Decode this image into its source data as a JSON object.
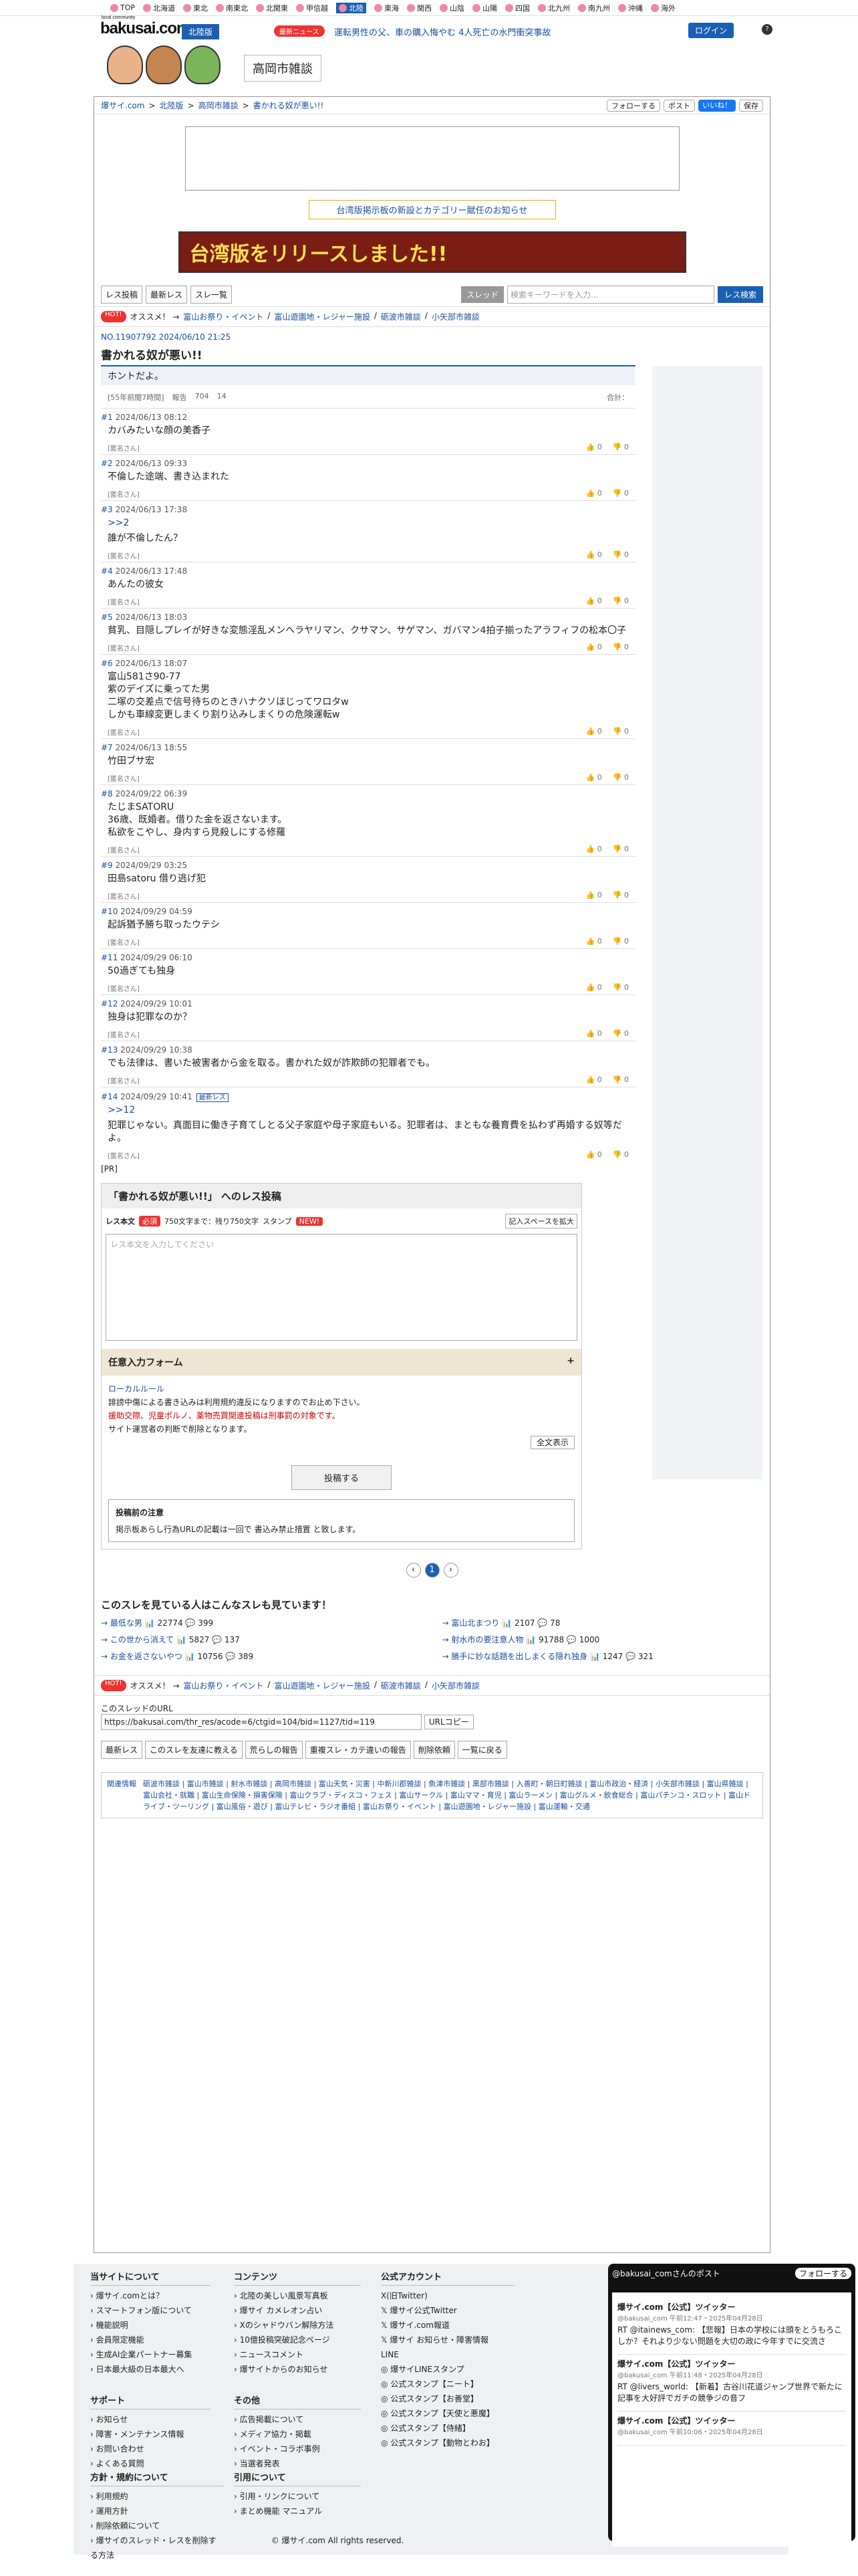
{
  "topnav": [
    "TOP",
    "北海道",
    "東北",
    "南東北",
    "北関東",
    "甲信越",
    "北陸",
    "東海",
    "関西",
    "山陰",
    "山陽",
    "四国",
    "北九州",
    "南九州",
    "沖縄",
    "海外"
  ],
  "topnav_active": "北陸",
  "header": {
    "logo": "bakusai.com",
    "logo_small": "local community",
    "region": "北陸版",
    "news_badge": "最新ニュース",
    "news_text": "運転男性の父、車の購入悔やむ 4人死亡の水門衝突事故",
    "login": "ログイン",
    "help": "?"
  },
  "bbs_label": "高岡市雑談",
  "breadcrumb": [
    "爆サイ.com",
    "北陸版",
    "高岡市雑談",
    "書かれる奴が悪い!!"
  ],
  "follow": {
    "x": "フォローする",
    "post": "ポスト",
    "fb": "いいね！",
    "save": "保存"
  },
  "notice": "台湾版掲示板の新設とカテゴリー賦任のお知らせ",
  "promo": "台湾版をリリースしました!!",
  "controls": {
    "btns": [
      "レス投稿",
      "最新レス",
      "スレ一覧"
    ],
    "select": "スレッド",
    "placeholder": "検索キーワードを入力...",
    "search": "レス検索"
  },
  "tags": {
    "hot": "HOT!",
    "label": "オススメ！ →",
    "items": [
      "富山お祭り・イベント",
      "富山遊園地・レジャー施設",
      "砺波市雑談",
      "小矢部市雑談"
    ]
  },
  "thread": {
    "no": "NO.11907792 2024/06/10 21:25",
    "title": "書かれる奴が悪い!!",
    "body": "ホントだよ。",
    "meta_views": "[55年前閲7時間]",
    "meta_report": "報告",
    "meta_count": "704",
    "meta_replies": "14",
    "total": "合計："
  },
  "responses": [
    {
      "no": "#1",
      "date": "2024/06/13 08:12",
      "body": "カバみたいな顔の美香子",
      "name": "[匿名さん]",
      "good": "0",
      "bad": "0"
    },
    {
      "no": "#2",
      "date": "2024/06/13 09:33",
      "body": "不倫した途端、書き込まれた",
      "name": "[匿名さん]",
      "good": "0",
      "bad": "0"
    },
    {
      "no": "#3",
      "date": "2024/06/13 17:38",
      "anchor": ">>2",
      "body": "誰が不倫したん？",
      "name": "[匿名さん]",
      "good": "0",
      "bad": "0"
    },
    {
      "no": "#4",
      "date": "2024/06/13 17:48",
      "body": "あんたの彼女",
      "name": "[匿名さん]",
      "good": "0",
      "bad": "0"
    },
    {
      "no": "#5",
      "date": "2024/06/13 18:03",
      "body": "貧乳、目隠しプレイが好きな変態淫乱メンヘラヤリマン、クサマン、サゲマン、ガバマン4拍子揃ったアラフィフの松本〇子",
      "name": "[匿名さん]",
      "good": "0",
      "bad": "0"
    },
    {
      "no": "#6",
      "date": "2024/06/13 18:07",
      "body": "富山581さ90-77\n紫のデイズに乗ってた男\n二塚の交差点で信号待ちのときハナクソほじってワロタw\nしかも車線変更しまくり割り込みしまくりの危険運転w",
      "name": "[匿名さん]",
      "good": "0",
      "bad": "0"
    },
    {
      "no": "#7",
      "date": "2024/06/13 18:55",
      "body": "竹田ブサ宏",
      "name": "[匿名さん]",
      "good": "0",
      "bad": "0"
    },
    {
      "no": "#8",
      "date": "2024/09/22 06:39",
      "body": "たじまSATORU\n36歳、既婚者。借りた金を返さないます。\n私欲をこやし、身内すら見殺しにする修羅",
      "name": "[匿名さん]",
      "good": "0",
      "bad": "0"
    },
    {
      "no": "#9",
      "date": "2024/09/29 03:25",
      "body": "田島satoru 借り逃げ犯",
      "name": "[匿名さん]",
      "good": "0",
      "bad": "0"
    },
    {
      "no": "#10",
      "date": "2024/09/29 04:59",
      "body": "起訴猶予勝ち取ったウテシ",
      "name": "[匿名さん]",
      "good": "0",
      "bad": "0"
    },
    {
      "no": "#11",
      "date": "2024/09/29 06:10",
      "body": "50過ぎても独身",
      "name": "[匿名さん]",
      "good": "0",
      "bad": "0"
    },
    {
      "no": "#12",
      "date": "2024/09/29 10:01",
      "body": "独身は犯罪なのか？",
      "name": "[匿名さん]",
      "good": "0",
      "bad": "0"
    },
    {
      "no": "#13",
      "date": "2024/09/29 10:38",
      "body": "でも法律は、書いた被害者から金を取る。書かれた奴が詐欺師の犯罪者でも。",
      "name": "[匿名さん]",
      "good": "0",
      "bad": "0"
    },
    {
      "no": "#14",
      "date": "2024/09/29 10:41",
      "latest": "最新レス",
      "anchor": ">>12",
      "body": "犯罪じゃない。真面目に働き子育てしとる父子家庭や母子家庭もいる。犯罪者は、まともな養育費を払わず再婚する奴等だよ。",
      "name": "[匿名さん]",
      "good": "0",
      "bad": "0"
    }
  ],
  "pr": "[PR]",
  "postform": {
    "title": "「書かれる奴が悪い!!」 へのレス投稿",
    "label": "レス本文",
    "required": "必須",
    "chars": "750文字まで：残り750文字",
    "stamp": "スタンプ",
    "new": "NEW!",
    "expand": "記入スペースを拡大",
    "placeholder": "レス本文を入力してください",
    "options": "任意入力フォーム",
    "rule": "ローカルルール",
    "rule1": "誹謗中傷による書き込みは利用規約違反になりますのでお止め下さい。",
    "rule2": "援助交際、児童ポルノ、薬物売買関連投稿は刑事罰の対象です。",
    "rule3": "サイト運営者の判断で削除となります。",
    "fullview": "全文表示",
    "submit": "投稿する",
    "caution_title": "投稿前の注意",
    "caution": "掲示板あらし行為URLの記載は一回で 書込み禁止措置 と致します。"
  },
  "pager": {
    "current": "1"
  },
  "seealso": {
    "title": "このスレを見ている人はこんなスレも見ています！",
    "back": "書かれる奴が悪い!!",
    "items": [
      {
        "t": "最低な男",
        "v": "22774",
        "r": "399"
      },
      {
        "t": "富山北まつり",
        "v": "2107",
        "r": "78"
      },
      {
        "t": "この世から消えて",
        "v": "5827",
        "r": "137"
      },
      {
        "t": "射水市の要注意人物",
        "v": "91788",
        "r": "1000"
      },
      {
        "t": "お金を返さないやつ",
        "v": "10756",
        "r": "389"
      },
      {
        "t": "勝手に妙な話題を出しまくる隠れ独身",
        "v": "1247",
        "r": "321"
      }
    ]
  },
  "url": {
    "label": "このスレッドのURL",
    "value": "https://bakusai.com/thr_res/acode=6/ctgid=104/bid=1127/tid=119",
    "copy": "URLコピー"
  },
  "bottombtns": [
    "最新レス",
    "このスレを友達に教える",
    "荒らしの報告",
    "重複スレ・カテ違いの報告",
    "削除依頼",
    "一覧に戻る"
  ],
  "related": {
    "label": "関連情報",
    "text": "砺波市雑談 | 富山市雑談 | 射水市雑談 | 高岡市雑談 | 富山天気・災害 | 中新川郡雑談 | 魚津市雑談 | 黒部市雑談 | 入善町・朝日町雑談 | 富山市政治・経済 | 小矢部市雑談 | 富山県雑談 | 富山会社・就職 | 富山生命保険・損害保険 | 富山クラブ・ディスコ・フェス | 富山サークル | 富山ママ・育児 | 富山ラーメン | 富山グルメ・飲食総合 | 富山パチンコ・スロット | 富山ドライブ・ツーリング | 富山風俗・遊び | 富山テレビ・ラジオ番組 | 富山お祭り・イベント | 富山遊園地・レジャー施設 | 富山運輸・交通"
  },
  "footer": {
    "c1": {
      "h": "当サイトについて",
      "items": [
        "爆サイ.comとは？",
        "スマートフォン版について",
        "機能説明",
        "会員限定機能",
        "生成AI企業パートナー募集",
        "日本最大級の日本最大へ"
      ]
    },
    "c2": {
      "h": "コンテンツ",
      "items": [
        "北陸の美しい風景写真板",
        "爆サイ カメレオン占い",
        "Xのシャドウバン解除方法",
        "10億投稿突破記念ページ",
        "ニュースコメント",
        "爆サイトからのお知らせ"
      ]
    },
    "c3": {
      "h": "サポート",
      "items": [
        "お知らせ",
        "障害・メンテナンス情報",
        "お問い合わせ",
        "よくある質問"
      ]
    },
    "c4": {
      "h": "その他",
      "items": [
        "広告掲載について",
        "メディア協力・掲載",
        "イベント・コラボ事例",
        "当選者発表"
      ]
    },
    "c5": {
      "h": "方針・規約について",
      "items": [
        "利用規約",
        "運用方針",
        "削除依頼について",
        "爆サイのスレッド・レスを削除する方法"
      ]
    },
    "c6": {
      "h": "引用について",
      "items": [
        "引用・リンクについて",
        "まとめ機能 マニュアル"
      ]
    },
    "c7": {
      "h": "公式アカウント",
      "x": "X(旧Twitter)",
      "items": [
        "爆サイ公式Twitter",
        "爆サイ.com報道",
        "爆サイ お知らせ・障害情報"
      ],
      "line": "LINE",
      "lineitems": [
        "爆サイLINEスタンプ",
        "公式スタンプ【ニート】",
        "公式スタンプ【お善堂】",
        "公式スタンプ【天使と悪魔】",
        "公式スタンプ【侍緒】",
        "公式スタンプ【動物とわお】"
      ]
    },
    "tw": {
      "head": "@bakusai_comさんのポスト",
      "follow": "フォローする",
      "posts": [
        {
          "n": "爆サイ.com【公式】ツイッター",
          "d": "@bakusai_com 午前12:47・2025年04月28日",
          "t": "RT @itainews_com: 【悲報】日本の学校には頭をとうもろこしか？それより少ない問題を大切の政に今年すでに交流さ"
        },
        {
          "n": "爆サイ.com【公式】ツイッター",
          "d": "@bakusai_com 午前11:48・2025年04月28日",
          "t": "RT @livers_world: 【新着】古谷川花道ジャンプ世界で新たに記事を大好評でガチの競争ジの音フ"
        },
        {
          "n": "爆サイ.com【公式】ツイッター",
          "d": "@bakusai_com 午前10:06・2025年04月28日",
          "t": ""
        }
      ]
    },
    "copyright": "© 爆サイ.com All rights reserved."
  }
}
